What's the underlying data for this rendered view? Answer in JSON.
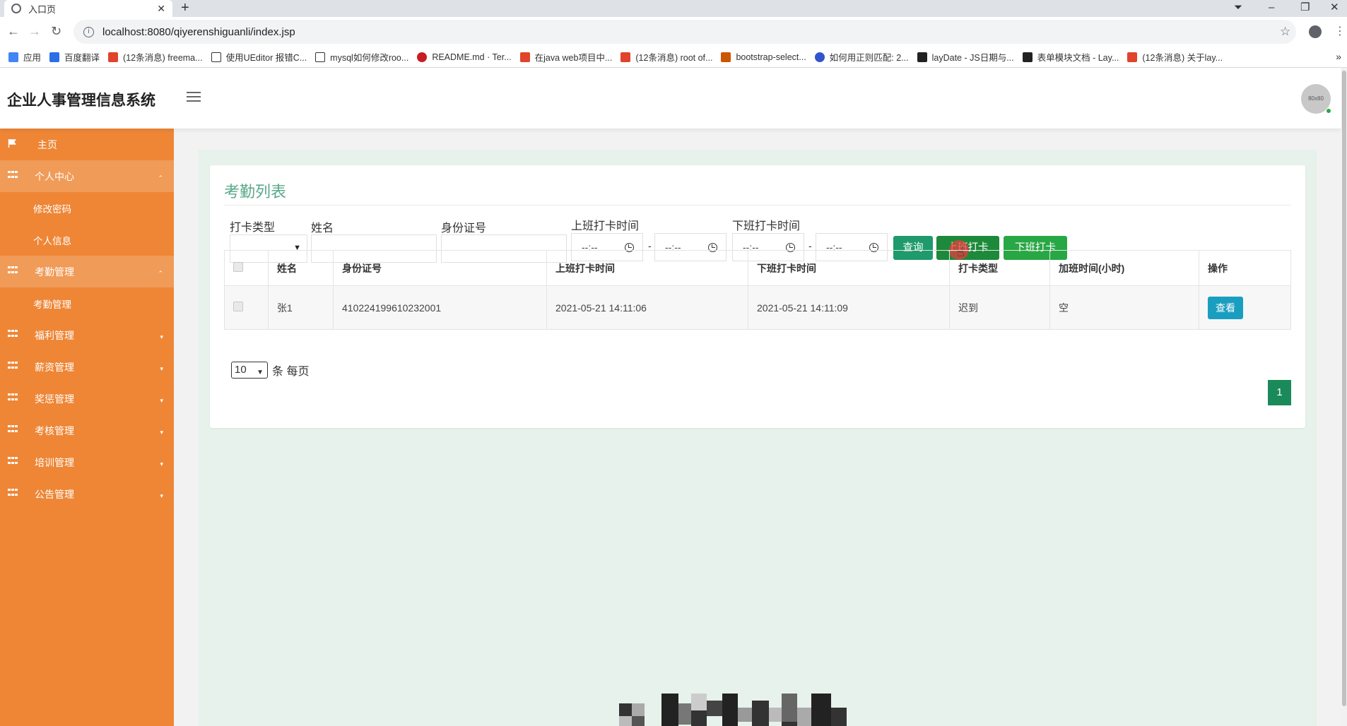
{
  "browser": {
    "tab_title": "入口页",
    "url": "localhost:8080/qiyerenshiguanli/index.jsp",
    "bookmarks": [
      {
        "label": "应用",
        "color": "#4285f4"
      },
      {
        "label": "百度翻译",
        "color": "#2a6ee8"
      },
      {
        "label": "(12条消息) freema...",
        "color": "#e0442a"
      },
      {
        "label": "使用UEditor 报错C...",
        "color": "#333333"
      },
      {
        "label": "mysql如何修改roo...",
        "color": "#333333"
      },
      {
        "label": "README.md · Ter...",
        "color": "#c71d23"
      },
      {
        "label": "在java web项目中...",
        "color": "#e0442a"
      },
      {
        "label": "(12条消息) root of...",
        "color": "#e0442a"
      },
      {
        "label": "bootstrap-select...",
        "color": "#cc5500"
      },
      {
        "label": "如何用正则匹配: 2...",
        "color": "#3355cc"
      },
      {
        "label": "layDate - JS日期与...",
        "color": "#222222"
      },
      {
        "label": "表单模块文档 - Lay...",
        "color": "#222222"
      },
      {
        "label": "(12条消息) 关于lay...",
        "color": "#e0442a"
      }
    ]
  },
  "header": {
    "title": "企业人事管理信息系统",
    "avatar_text": "80x80"
  },
  "sidebar": {
    "items": [
      {
        "label": "主页",
        "icon": "flag-icon"
      },
      {
        "label": "个人中心",
        "icon": "grid-icon",
        "caret": "⌃"
      },
      {
        "label": "修改密码"
      },
      {
        "label": "个人信息"
      },
      {
        "label": "考勤管理",
        "icon": "grid-icon",
        "caret": "⌃"
      },
      {
        "label": "考勤管理"
      },
      {
        "label": "福利管理",
        "icon": "grid-icon",
        "caret": "▾"
      },
      {
        "label": "薪资管理",
        "icon": "grid-icon",
        "caret": "▾"
      },
      {
        "label": "奖惩管理",
        "icon": "grid-icon",
        "caret": "▾"
      },
      {
        "label": "考核管理",
        "icon": "grid-icon",
        "caret": "▾"
      },
      {
        "label": "培训管理",
        "icon": "grid-icon",
        "caret": "▾"
      },
      {
        "label": "公告管理",
        "icon": "grid-icon",
        "caret": "▾"
      }
    ]
  },
  "panel": {
    "title": "考勤列表",
    "filters": {
      "type_label": "打卡类型",
      "name_label": "姓名",
      "id_label": "身份证号",
      "in_time_label": "上班打卡时间",
      "out_time_label": "下班打卡时间",
      "time_placeholder": "--:--",
      "dash": "-"
    },
    "buttons": {
      "query": "查询",
      "clock_in": "上班打卡",
      "clock_out": "下班打卡"
    },
    "table": {
      "headers": [
        "姓名",
        "身份证号",
        "上班打卡时间",
        "下班打卡时间",
        "打卡类型",
        "加班时间(小时)",
        "操作"
      ],
      "rows": [
        {
          "name": "张1",
          "id_number": "410224199610232001",
          "in_time": "2021-05-21 14:11:06",
          "out_time": "2021-05-21 14:11:09",
          "type": "迟到",
          "overtime": "空",
          "action": "查看"
        }
      ]
    },
    "pagination": {
      "page_size": "10",
      "page_size_suffix": "条 每页",
      "current_page": "1"
    }
  },
  "colors": {
    "sidebar": "#ee8636",
    "accent_green": "#1e9a6c",
    "title_green": "#5aa88a",
    "view_button": "#1a9ec0"
  }
}
